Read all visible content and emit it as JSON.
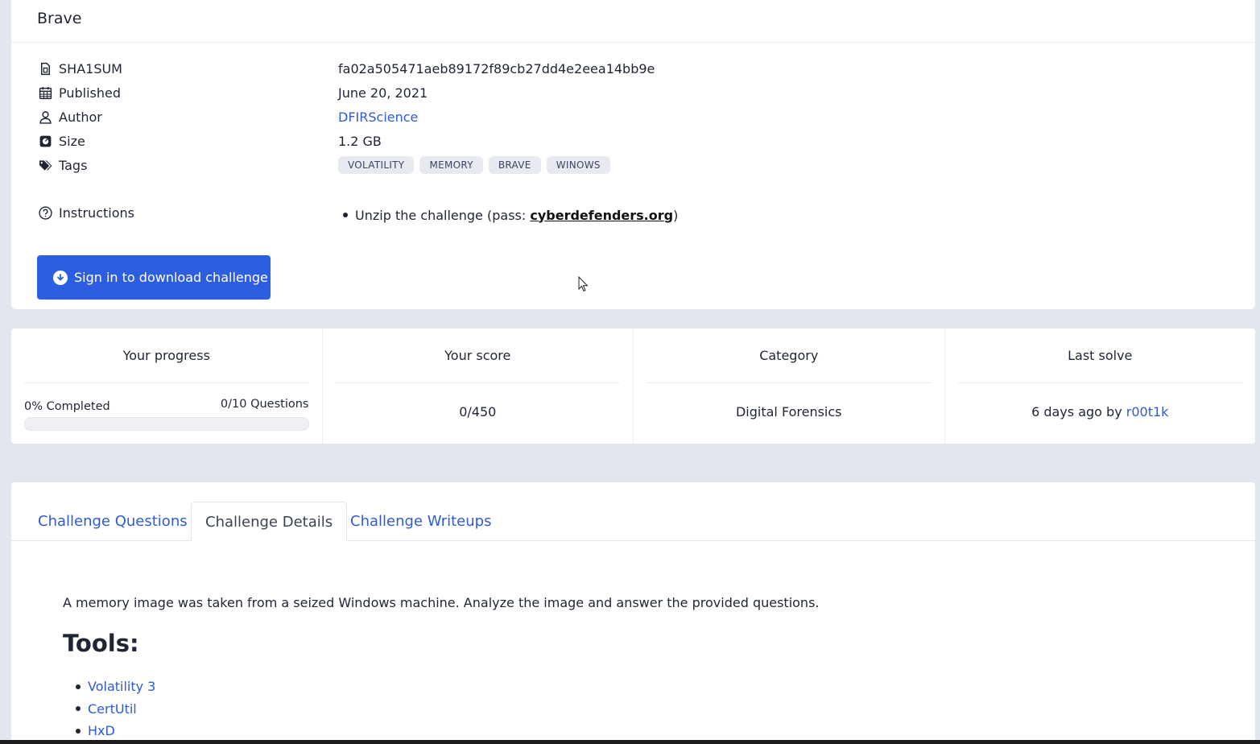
{
  "header": {
    "title": "Brave"
  },
  "meta": {
    "sha1": {
      "label": "SHA1SUM",
      "value": "fa02a505471aeb89172f89cb27dd4e2eea14bb9e"
    },
    "published": {
      "label": "Published",
      "value": "June 20, 2021"
    },
    "author": {
      "label": "Author",
      "value": "DFIRScience"
    },
    "size": {
      "label": "Size",
      "value": "1.2 GB"
    },
    "tags": {
      "label": "Tags",
      "items": [
        "VOLATILITY",
        "MEMORY",
        "BRAVE",
        "WINOWS"
      ]
    },
    "instructions": {
      "label": "Instructions",
      "prefix": "Unzip the challenge (pass: ",
      "password": "cyberdefenders.org",
      "suffix": ")"
    }
  },
  "download_button": {
    "label": "Sign in to download challenge"
  },
  "stats": {
    "progress": {
      "title": "Your progress",
      "completed": "0% Completed",
      "questions": "0/10 Questions",
      "fraction": 0
    },
    "score": {
      "title": "Your score",
      "value": "0/450"
    },
    "category": {
      "title": "Category",
      "value": "Digital Forensics"
    },
    "last_solve": {
      "title": "Last solve",
      "prefix": "6 days ago by",
      "user": "r00t1k"
    }
  },
  "tabs": [
    {
      "label": "Challenge Questions",
      "active": false
    },
    {
      "label": "Challenge Details",
      "active": true
    },
    {
      "label": "Challenge Writeups",
      "active": false
    }
  ],
  "details": {
    "description": "A memory image was taken from a seized Windows machine. Analyze the image and answer the provided questions.",
    "tools_heading": "Tools:",
    "tools": [
      "Volatility 3",
      "CertUtil",
      "HxD"
    ]
  },
  "colors": {
    "primary": "#2d5de0",
    "link": "#2f5bd3",
    "background": "#e2e6ee"
  }
}
